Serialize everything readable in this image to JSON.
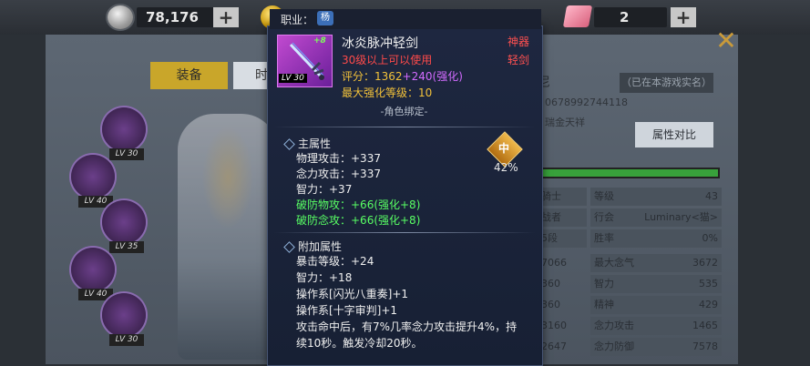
{
  "currency": {
    "coin_amount": "78,176",
    "gem_amount": "2",
    "plus": "+"
  },
  "tabs": {
    "equip": "装备",
    "other": "时"
  },
  "close": "✕",
  "slot_levels": [
    "LV 30",
    "LV 40",
    "LV 35",
    "LV 40",
    "LV 30"
  ],
  "right_panel": {
    "name": "尼",
    "tag": "（已在本游戏实名）",
    "uid": "0678992744118",
    "guild": "瑞金天祥",
    "compare": "属性对比",
    "rows_left": [
      "骑士",
      "战者",
      "5段"
    ],
    "rows_mid": [
      {
        "label": "等级",
        "value": "43"
      },
      {
        "label": "行会",
        "value": "Luminary<猫>"
      },
      {
        "label": "胜率",
        "value": "0%"
      }
    ],
    "stats_far": [
      "7066",
      "360",
      "360",
      "3160",
      "2647"
    ],
    "stats_labels": [
      {
        "label": "最大念气",
        "value": "3672"
      },
      {
        "label": "智力",
        "value": "535"
      },
      {
        "label": "精神",
        "value": "429"
      },
      {
        "label": "念力攻击",
        "value": "1465"
      },
      {
        "label": "念力防御",
        "value": "7578"
      }
    ]
  },
  "tooltip": {
    "job_label": "职业：",
    "job_badge": "杨",
    "item_plus": "+8",
    "item_lv": "LV 30",
    "name": "冰炎脉冲轻剑",
    "requirement": "30级以上可以使用",
    "rarity": "神器",
    "type": "轻剑",
    "score_label": "评分：1362",
    "score_bonus": "+240(强化)",
    "max_enhance": "最大强化等级：10",
    "bind": "-角色绑定-",
    "main_title": "主属性",
    "main_stats": [
      "物理攻击：+337",
      "念力攻击：+337",
      "智力：+37"
    ],
    "main_enhanced": [
      "破防物攻：+66(强化+8)",
      "破防念攻：+66(强化+8)"
    ],
    "medal": "中",
    "medal_percent": "42%",
    "extra_title": "附加属性",
    "extra_stats": [
      "暴击等级：+24",
      "智力：+18",
      "操作系[闪光八重奏]+1",
      "操作系[十字审判]+1"
    ],
    "effect_line1": "攻击命中后，有7%几率念力攻击提升4%，持",
    "effect_line2": "续10秒。触发冷却20秒。"
  }
}
